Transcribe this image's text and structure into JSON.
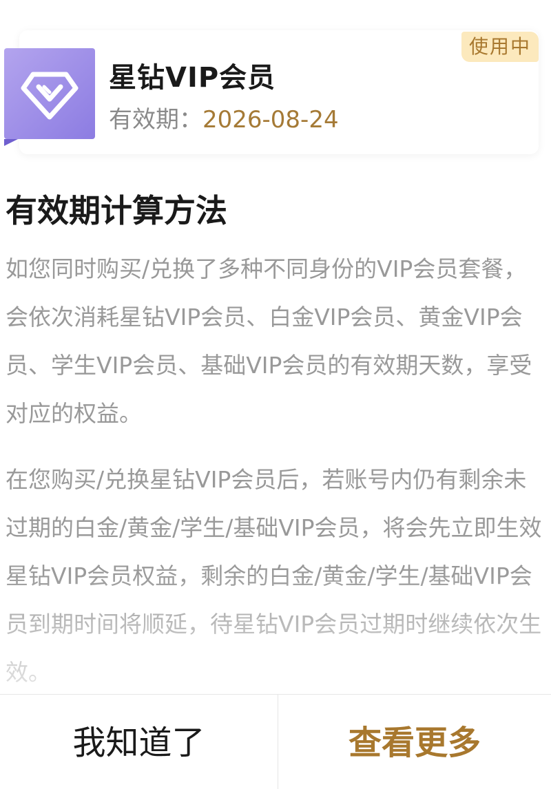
{
  "vip_card": {
    "icon": "diamond-v-icon",
    "title": "星钻VIP会员",
    "validity_label": "有效期：",
    "validity_date": "2026-08-24",
    "status_badge": "使用中",
    "colors": {
      "icon_gradient_start": "#b3a4ee",
      "icon_gradient_end": "#8c7ce2",
      "badge_bg": "#fce9bd",
      "accent_gold": "#a8782e"
    }
  },
  "section": {
    "title": "有效期计算方法",
    "paragraphs": [
      "如您同时购买/兑换了多种不同身份的VIP会员套餐，会依次消耗星钻VIP会员、白金VIP会员、黄金VIP会员、学生VIP会员、基础VIP会员的有效期天数，享受对应的权益。",
      "在您购买/兑换星钻VIP会员后，若账号内仍有剩余未过期的白金/黄金/学生/基础VIP会员，将会先立即生效星钻VIP会员权益，剩余的白金/黄金/学生/基础VIP会员到期时间将顺延，待星钻VIP会员过期时继续依次生效。"
    ]
  },
  "footer": {
    "ok_label": "我知道了",
    "more_label": "查看更多"
  }
}
